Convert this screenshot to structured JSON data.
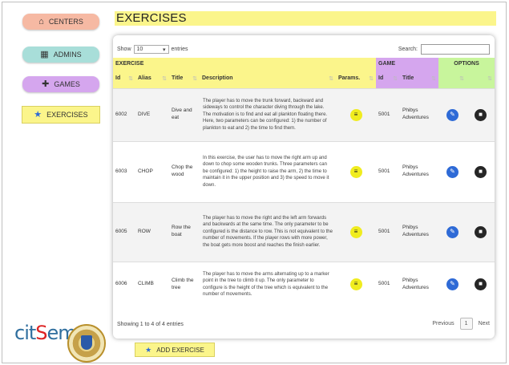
{
  "sidebar": {
    "items": [
      {
        "label": "CENTERS",
        "icon": "home-icon"
      },
      {
        "label": "ADMINS",
        "icon": "admin-icon"
      },
      {
        "label": "GAMES",
        "icon": "puzzle-icon"
      },
      {
        "label": "EXERCISES",
        "icon": "star-icon"
      }
    ]
  },
  "page": {
    "title": "EXERCISES"
  },
  "table_controls": {
    "show_label": "Show",
    "entries_value": "10",
    "entries_label": "entries",
    "search_label": "Search:",
    "search_value": ""
  },
  "table": {
    "groups": {
      "exercise": "EXERCISE",
      "game": "GAME",
      "options": "OPTIONS"
    },
    "columns": [
      "Id",
      "Alias",
      "Title",
      "Description",
      "Params.",
      "Id",
      "Title"
    ],
    "rows": [
      {
        "id": "6002",
        "alias": "DIVE",
        "title": "Dive and eat",
        "description": "The player has to move the trunk forward, backward and sideways to control the character diving through the lake. The motivation is to find and eat all plankton floating there. Here, two parameters can be configured: 1) the number of plankton to eat and 2) the time to find them.",
        "game_id": "5001",
        "game_title": "Phibys Adventures"
      },
      {
        "id": "6003",
        "alias": "CHOP",
        "title": "Chop the wood",
        "description": "In this exercise, the user has to move the right arm up and down to chop some wooden trunks. Three parameters can be configured: 1) the height to raise the arm, 2) the time to maintain it in the upper position and 3) the speed to move it down.",
        "game_id": "5001",
        "game_title": "Phibys Adventures"
      },
      {
        "id": "6005",
        "alias": "ROW",
        "title": "Row the boat",
        "description": "The player has to move the right and the left arm forwards and backwards at the same time. The only parameter to be configured is the distance to row. This is not equivalent to the number of movements. If the player rows with more power, the boat gets more boost and reaches the finish earlier.",
        "game_id": "5001",
        "game_title": "Phibys Adventures"
      },
      {
        "id": "6006",
        "alias": "CLIMB",
        "title": "Climb the tree",
        "description": "The player has to move the arms alternating up to a marker point in the tree to climb it up. The only parameter to configure is the height of the tree which is equivalent to the number of movements.",
        "game_id": "5001",
        "game_title": "Phibys Adventures"
      }
    ]
  },
  "pagination": {
    "info": "Showing 1 to 4 of 4 entries",
    "previous": "Previous",
    "current": "1",
    "next": "Next"
  },
  "actions": {
    "add_exercise": "ADD EXERCISE"
  },
  "logo": {
    "text_prefix": "cit",
    "text_s": "S",
    "text_suffix": "em"
  },
  "colors": {
    "exercise_accent": "#fbf58b",
    "game_accent": "#d5a6ee",
    "options_accent": "#c8f59c",
    "centers_accent": "#f6b9a3",
    "admins_accent": "#a8ded9",
    "edit_button": "#2e6ad6",
    "delete_button": "#262626",
    "params_button": "#f0ec1f"
  }
}
